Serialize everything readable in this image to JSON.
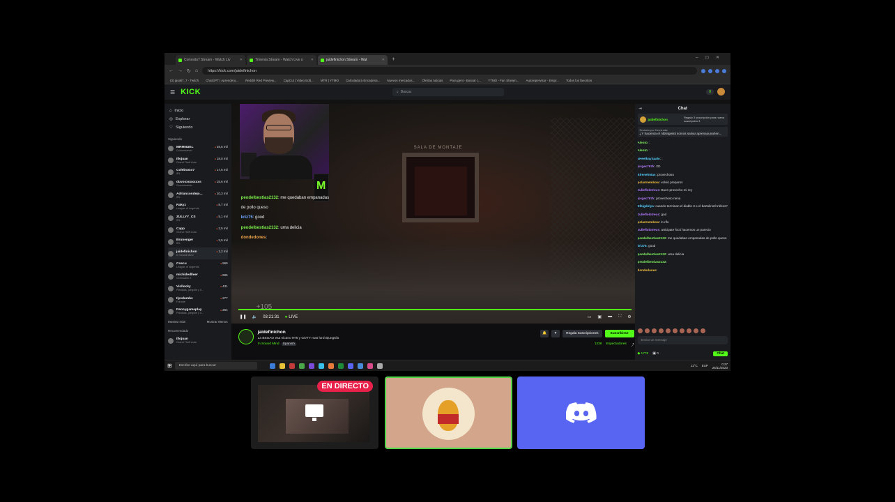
{
  "browser": {
    "tabs": [
      {
        "label": "Cortesito7 Stream - Watch Liv"
      },
      {
        "label": "Trinenia Stream - Watch Live o"
      },
      {
        "label": "jaidefinichon Stream - Wat"
      }
    ],
    "url": "https://kick.com/jaidefinichon",
    "bookmarks": [
      "(3) jasali7_7 - Twitch",
      "ChatGPT | Aprenderu...",
      "Reddit! Red Preview...",
      "CapCut | Video Edit...",
      "MTR | YTMO",
      "Calculadora Encadena...",
      "Nuevos mercados...",
      "Ofertas tuticias",
      "Para gent - Buscar c...",
      "YTMO - Fan Stream...",
      "Autorepervisor - Empr...",
      "Todos los favoritos"
    ]
  },
  "kick": {
    "logo": "KICK",
    "search_placeholder": "Buscar",
    "header_badge": "0",
    "nav": [
      {
        "icon": "home-icon",
        "label": "Inicio"
      },
      {
        "icon": "compass-icon",
        "label": "Explorar"
      },
      {
        "icon": "heart-icon",
        "label": "Siguiendo"
      }
    ],
    "following_heading": "Siguiendo",
    "channels": [
      {
        "name": "MRMNUEL",
        "game": "Conversando",
        "viewers": "28,5 mil"
      },
      {
        "name": "Illojuan",
        "game": "Grand Theft Auto",
        "viewers": "18,0 mil"
      },
      {
        "name": "Coleboxto7",
        "game": "IRL",
        "viewers": "17,5 mil"
      },
      {
        "name": "duvosxoxxxxxs",
        "game": "Conversando",
        "viewers": "15,6 mil"
      },
      {
        "name": "Adriancondejo...",
        "game": "IRL",
        "viewers": "10,3 mil"
      },
      {
        "name": "Rakyz",
        "game": "League of Legends",
        "viewers": "8,7 mil"
      },
      {
        "name": "ZULLYY_CS",
        "game": "IRL",
        "viewers": "5,1 mil"
      },
      {
        "name": "Capp",
        "game": "Grand Theft Auto",
        "viewers": "2,5 mil"
      },
      {
        "name": "Brunenger",
        "game": "IRL",
        "viewers": "2,5 mil"
      },
      {
        "name": "jaidefinichon",
        "game": "In Sound Mind",
        "viewers": "1,2 mil"
      },
      {
        "name": "Coscu",
        "game": "League of Legends",
        "viewers": "969"
      },
      {
        "name": "michidedlleer",
        "game": "Overwatch 2",
        "viewers": "695"
      },
      {
        "name": "Vicllocky",
        "game": "Plantaas, juegoile y ll...",
        "viewers": "431"
      },
      {
        "name": "Ilyedumbs",
        "game": "Fortnite",
        "viewers": "277"
      },
      {
        "name": "Pennygameplay",
        "game": "Plantaas, juegoile y ll...",
        "viewers": "264"
      }
    ],
    "show_more": "Mostrar más",
    "show_less": "Mostrar Menos",
    "recommended_heading": "Recomendado",
    "recommended": [
      {
        "name": "Illojuan",
        "game": "Grand Theft Auto"
      }
    ],
    "player": {
      "sign": "SALA DE MONTAJE",
      "overlay_chat": [
        {
          "user": "peodelbestias2132",
          "text": ": me quedaban empanadas de pollo queso"
        },
        {
          "user": "kriz75",
          "text": ": good"
        },
        {
          "user": "peodelbestias2132",
          "text": ": uma delicia"
        },
        {
          "user": "dondedones",
          "text": ":"
        }
      ],
      "overlay_stat": "+105",
      "time": "03:21:31",
      "live": "LIVE"
    },
    "stream": {
      "name": "jaidefinichon",
      "title": "La BSUAO esa nicano 9T6 y GOTY mas lord Bjungsilo",
      "category": "In Sound Mind",
      "tag": "Spanish",
      "gift_label": "Regala Suscripciones",
      "subscribe_label": "Suscribirse",
      "viewers": "1236",
      "viewers_label": "Espectadores"
    },
    "chat": {
      "title": "Chat",
      "pinned_user": "jaidefinichon",
      "pinned_text": "Regalo 3 suscripción para nueva suscripción 3",
      "poll_header": "Enviado por",
      "poll_user": "Kerninoke",
      "poll_text": "¿Y hacienta el ntbli4geisti somos salvar aprenaounahen...",
      "messages": [
        {
          "user": "Alento",
          "text": ":"
        },
        {
          "user": "Alento",
          "text": ":"
        },
        {
          "user": "xHeelkaySaalo",
          "text": ":"
        },
        {
          "user": "jorgec767k",
          "text": "XD"
        },
        {
          "user": "Elrenelmtas",
          "text": "provechoso"
        },
        {
          "user": "polarmembow",
          "text": "volvió preparos"
        },
        {
          "user": "Julieflolotreus",
          "text": "Buen provecho mi rey"
        },
        {
          "user": "jorgec767k",
          "text": "provechoso nena"
        },
        {
          "user": "Elbigdolya",
          "text": "cuando terminan el diablo 3 o el bartolinotl triékes?"
        },
        {
          "user": "Julieflolotreus",
          "text": "god"
        },
        {
          "user": "polarmembow",
          "text": "lo rifo"
        },
        {
          "user": "Julieflolotreus",
          "text": "articipate focó hacemos un parecio"
        },
        {
          "user": "peodelbestias2132",
          "text": "me quedaban empanadas de pollo queso"
        },
        {
          "user": "kriz75",
          "text": "good"
        },
        {
          "user": "peodelbestias2132",
          "text": "uma delicia"
        },
        {
          "user": "peodelbestias2132",
          "text": ""
        },
        {
          "user": "dondedones",
          "text": ""
        }
      ],
      "input_placeholder": "Enviar un mensaje",
      "points": "1776",
      "count": "0",
      "send_label": "Chat"
    }
  },
  "taskbar": {
    "search_placeholder": "Escribe aquí para buscar",
    "temp": "11°C",
    "lang": "ESP",
    "time": "0:27",
    "date": "26/11/2023"
  },
  "tiles": {
    "live_badge": "EN DIRECTO"
  },
  "colors": {
    "kick_green": "#53fc18",
    "discord": "#5865f2",
    "live_red": "#e8214a"
  }
}
